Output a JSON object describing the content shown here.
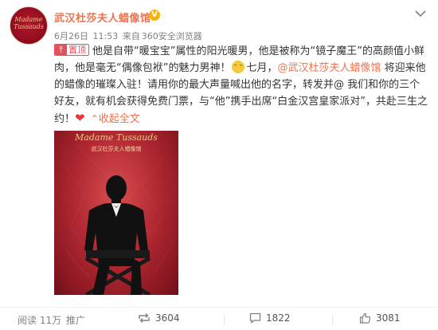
{
  "account": {
    "name": "武汉杜莎夫人蜡像馆",
    "verified_badge": "V",
    "logo_line1": "Madame",
    "logo_line2": "Tussauds"
  },
  "meta": {
    "date": "6月26日",
    "time": "11:53",
    "from_label": "来自",
    "source": "360安全浏览器"
  },
  "post": {
    "pin_label": "置顶",
    "text_1": "他是自带“暖宝宝”属性的阳光暖男，他是被称为“镜子魔王”的高颜值小鲜肉，他是毫无“偶像包袱”的魅力男神！",
    "text_2": "七月，",
    "mention": "@武汉杜莎夫人蜡像馆",
    "text_3": " 将迎来他的蜡像的璀璨入驻！请用你的最大声量喊出他的名字，转发并@ 我们和你的三个好友，就有机会获得免费门票，与“他”携手出席“白金汉宫皇家派对”，共赴三生之约！",
    "collapse_label": "收起全文",
    "collapse_icon": "chevron-up-icon",
    "heart_icon": "heart-icon",
    "emoji_icon": "squint-smile-emoji"
  },
  "poster": {
    "title": "Madame Tussauds",
    "subtitle": "武汉杜莎夫人蜡像馆"
  },
  "footer": {
    "reads": "阅读 11万",
    "promote": "推广",
    "repost_count": "3604",
    "comment_count": "1822",
    "like_count": "3081"
  },
  "colors": {
    "accent": "#eb7350",
    "pin_red": "#e5505b",
    "verified_gold": "#f7b500",
    "poster_red": "#b32a33"
  }
}
